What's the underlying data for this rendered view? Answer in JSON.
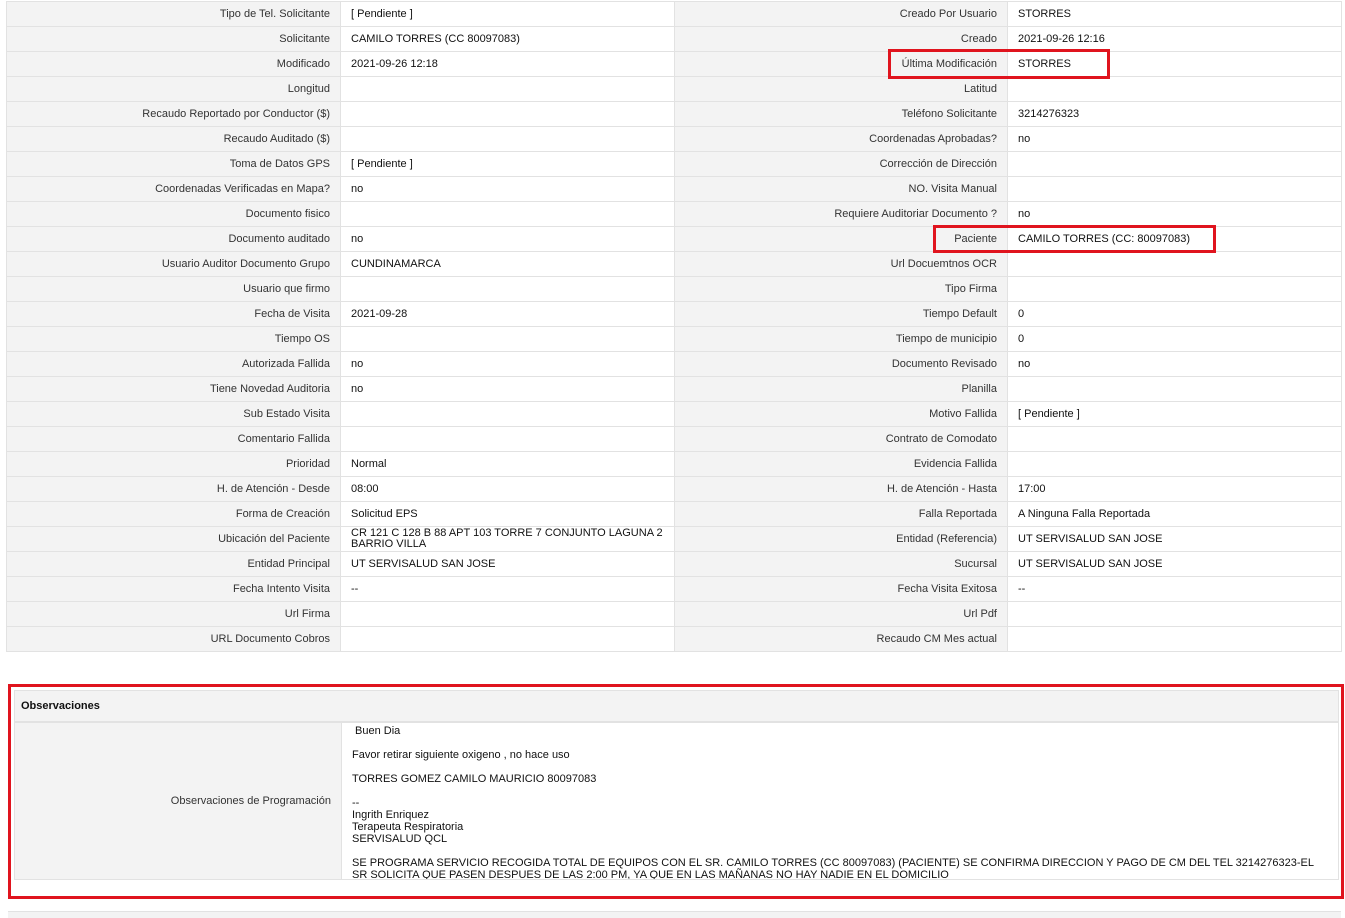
{
  "rows": [
    {
      "l1": "Tipo de Tel. Solicitante",
      "v1": "[ Pendiente ]",
      "l2": "Creado Por Usuario",
      "v2": "STORRES"
    },
    {
      "l1": "Solicitante",
      "v1": "CAMILO TORRES (CC 80097083)",
      "l2": "Creado",
      "v2": "2021-09-26 12:16"
    },
    {
      "l1": "Modificado",
      "v1": "2021-09-26 12:18",
      "l2": "Última Modificación",
      "v2": "STORRES"
    },
    {
      "l1": "Longitud",
      "v1": "",
      "l2": "Latitud",
      "v2": ""
    },
    {
      "l1": "Recaudo Reportado por Conductor ($)",
      "v1": "",
      "l2": "Teléfono Solicitante",
      "v2": "3214276323"
    },
    {
      "l1": "Recaudo Auditado ($)",
      "v1": "",
      "l2": "Coordenadas Aprobadas?",
      "v2": "no"
    },
    {
      "l1": "Toma de Datos GPS",
      "v1": "[ Pendiente ]",
      "l2": "Corrección de Dirección",
      "v2": ""
    },
    {
      "l1": "Coordenadas Verificadas en Mapa?",
      "v1": "no",
      "l2": "NO. Visita Manual",
      "v2": ""
    },
    {
      "l1": "Documento fisico",
      "v1": "",
      "l2": "Requiere Auditoriar Documento ?",
      "v2": "no"
    },
    {
      "l1": "Documento auditado",
      "v1": "no",
      "l2": "Paciente",
      "v2": "CAMILO TORRES (CC: 80097083)"
    },
    {
      "l1": "Usuario Auditor Documento Grupo",
      "v1": "CUNDINAMARCA",
      "l2": "Url Docuemtnos OCR",
      "v2": ""
    },
    {
      "l1": "Usuario que firmo",
      "v1": "",
      "l2": "Tipo Firma",
      "v2": ""
    },
    {
      "l1": "Fecha de Visita",
      "v1": "2021-09-28",
      "l2": "Tiempo Default",
      "v2": "0"
    },
    {
      "l1": "Tiempo OS",
      "v1": "",
      "l2": "Tiempo de municipio",
      "v2": "0"
    },
    {
      "l1": "Autorizada Fallida",
      "v1": "no",
      "l2": "Documento Revisado",
      "v2": "no"
    },
    {
      "l1": "Tiene Novedad Auditoria",
      "v1": "no",
      "l2": "Planilla",
      "v2": ""
    },
    {
      "l1": "Sub Estado Visita",
      "v1": "",
      "l2": "Motivo Fallida",
      "v2": "[ Pendiente ]"
    },
    {
      "l1": "Comentario Fallida",
      "v1": "",
      "l2": "Contrato de Comodato",
      "v2": ""
    },
    {
      "l1": "Prioridad",
      "v1": "Normal",
      "l2": "Evidencia Fallida",
      "v2": ""
    },
    {
      "l1": "H. de Atención - Desde",
      "v1": "08:00",
      "l2": "H. de Atención - Hasta",
      "v2": "17:00"
    },
    {
      "l1": "Forma de Creación",
      "v1": "Solicitud EPS",
      "l2": "Falla Reportada",
      "v2": "A Ninguna Falla Reportada"
    },
    {
      "l1": "Ubicación del Paciente",
      "v1": "CR 121 C 128 B 88 APT 103 TORRE 7 CONJUNTO LAGUNA 2 BARRIO VILLA",
      "l2": "Entidad (Referencia)",
      "v2": "UT SERVISALUD SAN JOSE"
    },
    {
      "l1": "Entidad Principal",
      "v1": "UT SERVISALUD SAN JOSE",
      "l2": "Sucursal",
      "v2": "UT SERVISALUD SAN JOSE"
    },
    {
      "l1": "Fecha Intento Visita",
      "v1": "--",
      "l2": "Fecha Visita Exitosa",
      "v2": "--"
    },
    {
      "l1": "Url Firma",
      "v1": "",
      "l2": "Url Pdf",
      "v2": ""
    },
    {
      "l1": "URL Documento Cobros",
      "v1": "",
      "l2": "Recaudo CM Mes actual",
      "v2": ""
    }
  ],
  "observaciones": {
    "title": "Observaciones",
    "label": "Observaciones de Programación",
    "greeting": "Buen Dia",
    "request": "Favor retirar siguiente oxigeno , no hace uso",
    "patient": "TORRES GOMEZ CAMILO MAURICIO 80097083",
    "sig_sep": "--",
    "sig_name": "Ingrith Enriquez",
    "sig_role": "Terapeuta Respiratoria",
    "sig_org": "SERVISALUD QCL",
    "note": " SE PROGRAMA SERVICIO RECOGIDA TOTAL DE EQUIPOS CON EL SR. CAMILO TORRES (CC 80097083) (PACIENTE) SE CONFIRMA DIRECCION Y PAGO DE CM DEL TEL 3214276323-EL SR SOLICITA QUE PASEN DESPUES DE LAS 2:00 PM, YA QUE EN LAS MAÑANAS NO HAY NADIE EN EL DOMICILIO"
  },
  "highlight_color": "#e0141e"
}
